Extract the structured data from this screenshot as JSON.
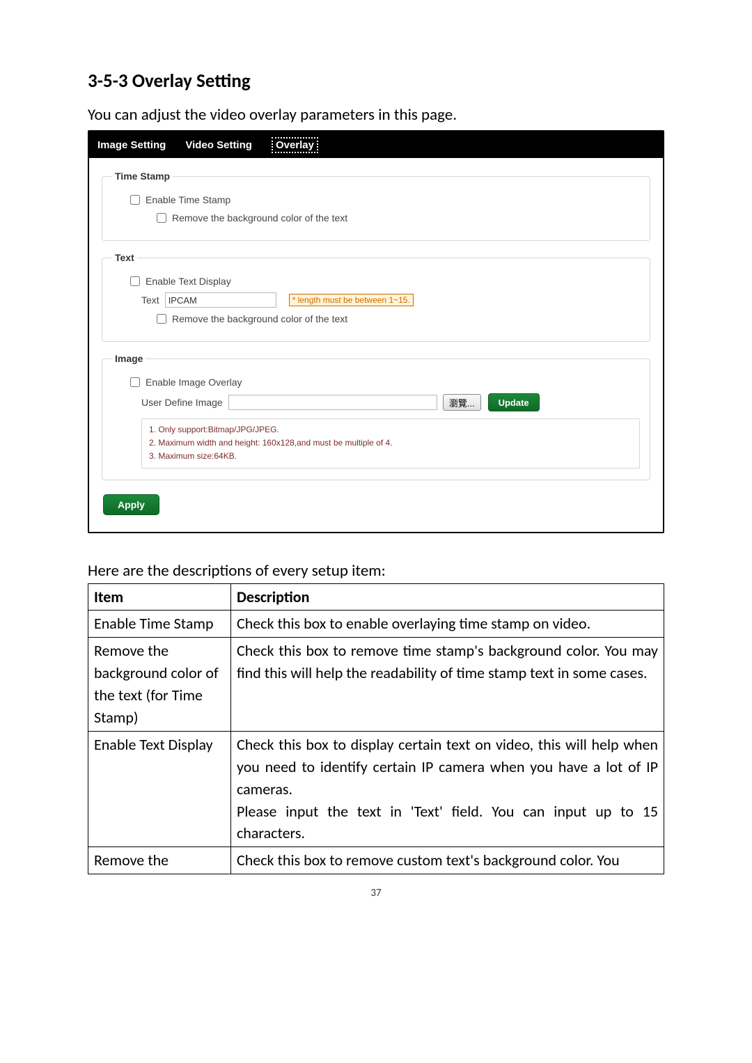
{
  "heading": "3-5-3 Overlay Setting",
  "intro": "You can adjust the video overlay parameters in this page.",
  "tabs": {
    "image_setting": "Image Setting",
    "video_setting": "Video Setting",
    "overlay": "Overlay"
  },
  "time_stamp": {
    "legend": "Time Stamp",
    "enable": "Enable Time Stamp",
    "remove_bg": "Remove the background color of the text"
  },
  "text": {
    "legend": "Text",
    "enable": "Enable Text Display",
    "label": "Text",
    "value": "IPCAM",
    "hint": "* length must be between 1~15.",
    "remove_bg": "Remove the background color of the text"
  },
  "image": {
    "legend": "Image",
    "enable": "Enable Image Overlay",
    "udi_label": "User Define Image",
    "browse": "瀏覽...",
    "update": "Update",
    "notes": {
      "n1": "1. Only support:Bitmap/JPG/JPEG.",
      "n2": "2. Maximum width and height: 160x128,and must be multiple of 4.",
      "n3": "3. Maximum size:64KB."
    }
  },
  "apply": "Apply",
  "table_caption": "Here are the descriptions of every setup item:",
  "table": {
    "h1": "Item",
    "h2": "Description",
    "r1c1": "Enable Time Stamp",
    "r1c2": "Check this box to enable overlaying time stamp on video.",
    "r2c1": "Remove the background color of the text (for Time Stamp)",
    "r2c2": "Check this box to remove time stamp's background color. You may find this will help the readability of time stamp text in some cases.",
    "r3c1": "Enable Text Display",
    "r3c2a": "Check this box to display certain text on video, this will help when you need to identify certain IP camera when you have a lot of IP cameras.",
    "r3c2b": "Please input the text in 'Text' field. You can input up to 15 characters.",
    "r4c1": "Remove the",
    "r4c2": "Check this box to remove custom text's background color. You"
  },
  "page_number": "37"
}
